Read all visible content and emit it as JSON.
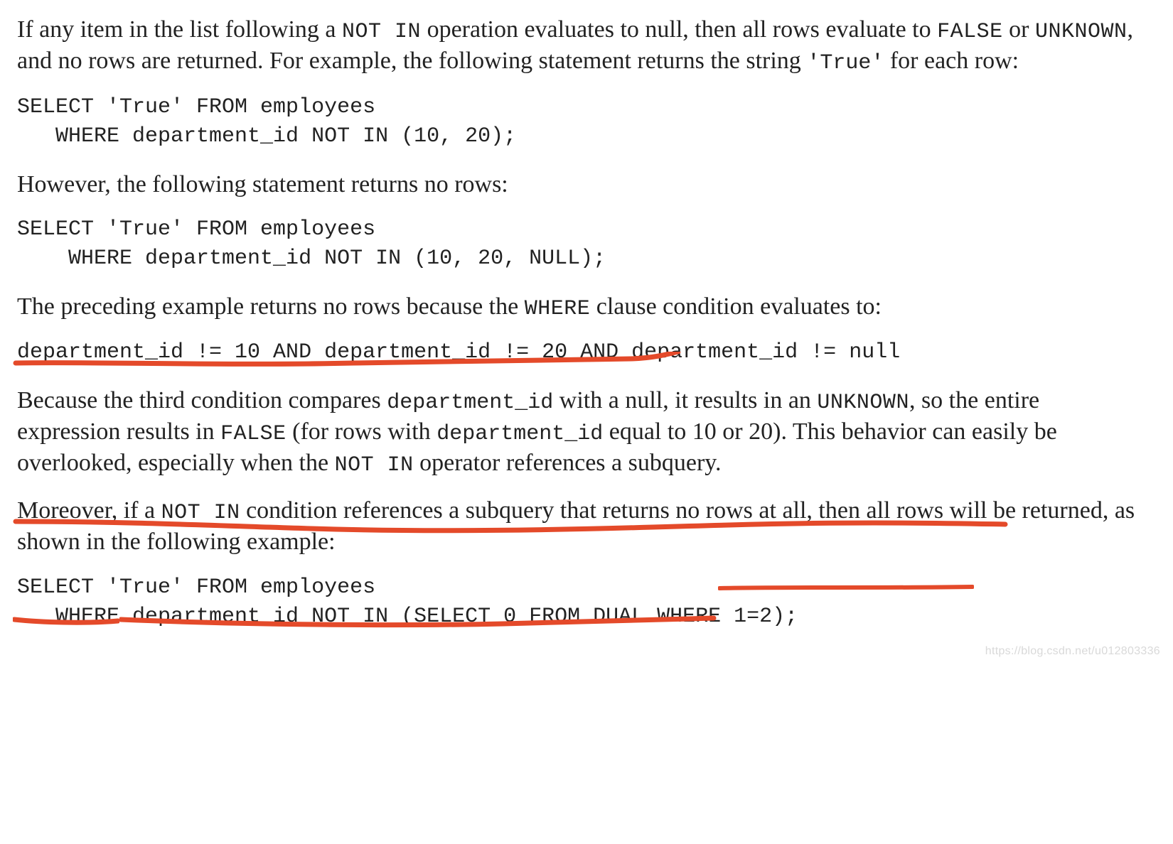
{
  "para1": {
    "t1": "If any item in the list following a ",
    "c1": "NOT IN",
    "t2": " operation evaluates to null, then all rows evaluate to ",
    "c2": "FALSE",
    "t3": " or ",
    "c3": "UNKNOWN",
    "t4": ", and no rows are returned. For example, the following statement returns the string ",
    "c4": "'True'",
    "t5": " for each row:"
  },
  "code1": "SELECT 'True' FROM employees\n   WHERE department_id NOT IN (10, 20);",
  "para2": "However, the following statement returns no rows:",
  "code2": "SELECT 'True' FROM employees\n    WHERE department_id NOT IN (10, 20, NULL);",
  "para3": {
    "t1": "The preceding example returns no rows because the ",
    "c1": "WHERE",
    "t2": " clause condition evaluates to:"
  },
  "code3": "department_id != 10 AND department_id != 20 AND department_id != null",
  "para4": {
    "t1": "Because the third condition compares ",
    "c1": "department_id",
    "t2": " with a null, it results in an ",
    "c2": "UNKNOWN",
    "t3": ", so the entire expression results in ",
    "c3": "FALSE",
    "t4": " (for rows with ",
    "c4": "department_id",
    "t5": " equal to 10 or 20). This behavior can easily be overlooked, especially when the ",
    "c5": "NOT IN",
    "t6": " operator references a subquery."
  },
  "para5": {
    "t1": "Moreover, if a ",
    "c1": "NOT IN",
    "t2": " condition references a subquery that returns no rows at all, then all rows will be returned, as shown in the following example:"
  },
  "code4": "SELECT 'True' FROM employees\n   WHERE department_id NOT IN (SELECT 0 FROM DUAL WHERE 1=2);",
  "watermark": "https://blog.csdn.net/u012803336",
  "annotation_color": "#e44a2a"
}
